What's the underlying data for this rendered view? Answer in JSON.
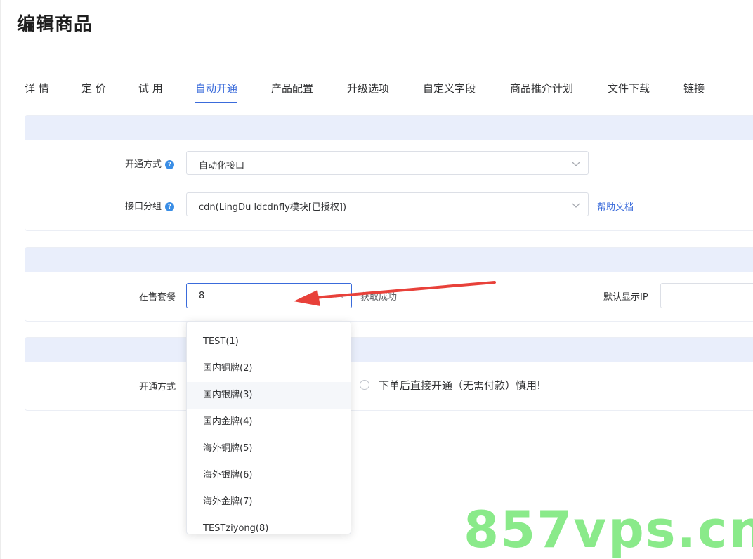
{
  "page": {
    "title": "编辑商品"
  },
  "tabs": [
    {
      "label": "详 情"
    },
    {
      "label": "定 价"
    },
    {
      "label": "试 用"
    },
    {
      "label": "自动开通",
      "active": true
    },
    {
      "label": "产品配置"
    },
    {
      "label": "升级选项"
    },
    {
      "label": "自定义字段"
    },
    {
      "label": "商品推介计划"
    },
    {
      "label": "文件下载"
    },
    {
      "label": "链接"
    }
  ],
  "section1": {
    "open_mode_label": "开通方式",
    "open_mode_value": "自动化接口",
    "api_group_label": "接口分组",
    "api_group_value": "cdn(LingDu ldcdnfly模块[已授权])",
    "help_link": "帮助文档"
  },
  "section2": {
    "package_label": "在售套餐",
    "package_value": "8",
    "fetch_status": "获取成功",
    "default_ip_label": "默认显示IP"
  },
  "section3": {
    "open_mode_label": "开通方式",
    "radio_option": "下单后直接开通（无需付款）慎用!"
  },
  "dropdown": {
    "options": [
      "TEST(1)",
      "国内铜牌(2)",
      "国内银牌(3)",
      "国内金牌(4)",
      "海外铜牌(5)",
      "海外银牌(6)",
      "海外金牌(7)",
      "TESTziyong(8)"
    ],
    "hovered_index": 2
  },
  "watermark": {
    "text": "857vps.cn"
  },
  "colors": {
    "accent": "#3a6bdb",
    "panel_header": "#e9eefb",
    "annotation_arrow": "#e8413a",
    "watermark": "#7ee87e"
  },
  "icons": {
    "help": "question-circle-icon",
    "select_arrow": "chevron-down-icon",
    "select_arrow_open": "chevron-up-icon"
  }
}
